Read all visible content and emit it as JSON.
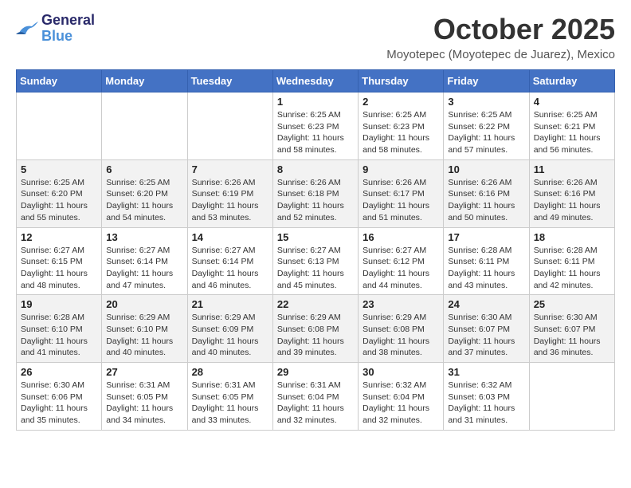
{
  "header": {
    "logo_line1": "General",
    "logo_line2": "Blue",
    "month": "October 2025",
    "location": "Moyotepec (Moyotepec de Juarez), Mexico"
  },
  "days_of_week": [
    "Sunday",
    "Monday",
    "Tuesday",
    "Wednesday",
    "Thursday",
    "Friday",
    "Saturday"
  ],
  "weeks": [
    [
      {
        "day": "",
        "info": ""
      },
      {
        "day": "",
        "info": ""
      },
      {
        "day": "",
        "info": ""
      },
      {
        "day": "1",
        "info": "Sunrise: 6:25 AM\nSunset: 6:23 PM\nDaylight: 11 hours\nand 58 minutes."
      },
      {
        "day": "2",
        "info": "Sunrise: 6:25 AM\nSunset: 6:23 PM\nDaylight: 11 hours\nand 58 minutes."
      },
      {
        "day": "3",
        "info": "Sunrise: 6:25 AM\nSunset: 6:22 PM\nDaylight: 11 hours\nand 57 minutes."
      },
      {
        "day": "4",
        "info": "Sunrise: 6:25 AM\nSunset: 6:21 PM\nDaylight: 11 hours\nand 56 minutes."
      }
    ],
    [
      {
        "day": "5",
        "info": "Sunrise: 6:25 AM\nSunset: 6:20 PM\nDaylight: 11 hours\nand 55 minutes."
      },
      {
        "day": "6",
        "info": "Sunrise: 6:25 AM\nSunset: 6:20 PM\nDaylight: 11 hours\nand 54 minutes."
      },
      {
        "day": "7",
        "info": "Sunrise: 6:26 AM\nSunset: 6:19 PM\nDaylight: 11 hours\nand 53 minutes."
      },
      {
        "day": "8",
        "info": "Sunrise: 6:26 AM\nSunset: 6:18 PM\nDaylight: 11 hours\nand 52 minutes."
      },
      {
        "day": "9",
        "info": "Sunrise: 6:26 AM\nSunset: 6:17 PM\nDaylight: 11 hours\nand 51 minutes."
      },
      {
        "day": "10",
        "info": "Sunrise: 6:26 AM\nSunset: 6:16 PM\nDaylight: 11 hours\nand 50 minutes."
      },
      {
        "day": "11",
        "info": "Sunrise: 6:26 AM\nSunset: 6:16 PM\nDaylight: 11 hours\nand 49 minutes."
      }
    ],
    [
      {
        "day": "12",
        "info": "Sunrise: 6:27 AM\nSunset: 6:15 PM\nDaylight: 11 hours\nand 48 minutes."
      },
      {
        "day": "13",
        "info": "Sunrise: 6:27 AM\nSunset: 6:14 PM\nDaylight: 11 hours\nand 47 minutes."
      },
      {
        "day": "14",
        "info": "Sunrise: 6:27 AM\nSunset: 6:14 PM\nDaylight: 11 hours\nand 46 minutes."
      },
      {
        "day": "15",
        "info": "Sunrise: 6:27 AM\nSunset: 6:13 PM\nDaylight: 11 hours\nand 45 minutes."
      },
      {
        "day": "16",
        "info": "Sunrise: 6:27 AM\nSunset: 6:12 PM\nDaylight: 11 hours\nand 44 minutes."
      },
      {
        "day": "17",
        "info": "Sunrise: 6:28 AM\nSunset: 6:11 PM\nDaylight: 11 hours\nand 43 minutes."
      },
      {
        "day": "18",
        "info": "Sunrise: 6:28 AM\nSunset: 6:11 PM\nDaylight: 11 hours\nand 42 minutes."
      }
    ],
    [
      {
        "day": "19",
        "info": "Sunrise: 6:28 AM\nSunset: 6:10 PM\nDaylight: 11 hours\nand 41 minutes."
      },
      {
        "day": "20",
        "info": "Sunrise: 6:29 AM\nSunset: 6:10 PM\nDaylight: 11 hours\nand 40 minutes."
      },
      {
        "day": "21",
        "info": "Sunrise: 6:29 AM\nSunset: 6:09 PM\nDaylight: 11 hours\nand 40 minutes."
      },
      {
        "day": "22",
        "info": "Sunrise: 6:29 AM\nSunset: 6:08 PM\nDaylight: 11 hours\nand 39 minutes."
      },
      {
        "day": "23",
        "info": "Sunrise: 6:29 AM\nSunset: 6:08 PM\nDaylight: 11 hours\nand 38 minutes."
      },
      {
        "day": "24",
        "info": "Sunrise: 6:30 AM\nSunset: 6:07 PM\nDaylight: 11 hours\nand 37 minutes."
      },
      {
        "day": "25",
        "info": "Sunrise: 6:30 AM\nSunset: 6:07 PM\nDaylight: 11 hours\nand 36 minutes."
      }
    ],
    [
      {
        "day": "26",
        "info": "Sunrise: 6:30 AM\nSunset: 6:06 PM\nDaylight: 11 hours\nand 35 minutes."
      },
      {
        "day": "27",
        "info": "Sunrise: 6:31 AM\nSunset: 6:05 PM\nDaylight: 11 hours\nand 34 minutes."
      },
      {
        "day": "28",
        "info": "Sunrise: 6:31 AM\nSunset: 6:05 PM\nDaylight: 11 hours\nand 33 minutes."
      },
      {
        "day": "29",
        "info": "Sunrise: 6:31 AM\nSunset: 6:04 PM\nDaylight: 11 hours\nand 32 minutes."
      },
      {
        "day": "30",
        "info": "Sunrise: 6:32 AM\nSunset: 6:04 PM\nDaylight: 11 hours\nand 32 minutes."
      },
      {
        "day": "31",
        "info": "Sunrise: 6:32 AM\nSunset: 6:03 PM\nDaylight: 11 hours\nand 31 minutes."
      },
      {
        "day": "",
        "info": ""
      }
    ]
  ]
}
